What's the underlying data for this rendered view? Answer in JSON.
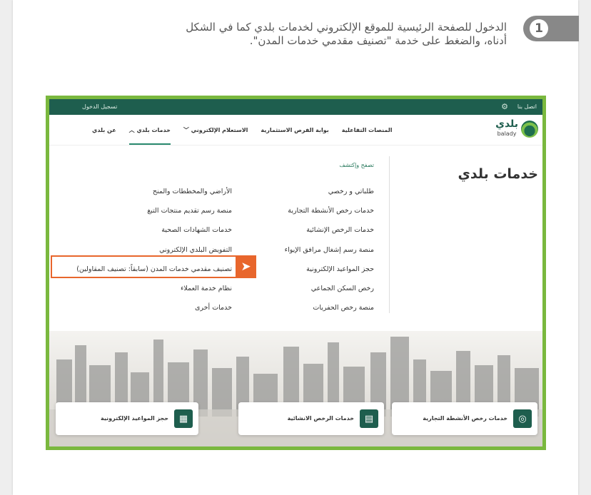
{
  "step": {
    "number": "1",
    "line1": "الدخول للصفحة الرئيسية للموقع الإلكتروني لخدمات بلدي كما في الشكل",
    "line2": "أدناه، والضغط على خدمة \"تصنيف مقدمي خدمات المدن\"."
  },
  "site": {
    "topbar": {
      "contact": "اتصل بنا",
      "login": "تسجيل الدخول",
      "settings_icon": "gear-icon"
    },
    "logo": {
      "ar": "بلدي",
      "en": "balady"
    },
    "nav": [
      "عن بلدي",
      "خدمات بلدي",
      "الاستعلام الإلكتروني",
      "بوابة الفرص الاستثمارية",
      "المنصات التفاعلية"
    ],
    "menu_title": "خدمات بلدي",
    "explore": "تصفح وإكتشف",
    "col_right": [
      "طلباتي و رخصي",
      "خدمات رخص الأنشطة التجارية",
      "خدمات الرخص الإنشائية",
      "منصة رسم إشغال مرافق الإيواء",
      "حجز المواعيد الإلكترونية",
      "رخص السكن الجماعي",
      "منصة رخص الحفريات"
    ],
    "col_left": [
      "الأراضي والمخططات والمنح",
      "منصة رسم تقديم منتجات التبغ",
      "خدمات الشهادات الصحية",
      "التفويض البلدي الإلكتروني",
      "تصنيف مقدمي خدمات المدن (سابقاً: تصنيف المقاولين)",
      "نظام خدمة العملاء",
      "خدمات أخرى"
    ],
    "cards": [
      "خدمات رخص الأنشطة التجارية",
      "خدمات الرخص الانشائية",
      "حجز المواعيد الإلكترونية"
    ],
    "colors": {
      "brand": "#1e5e4e",
      "accent": "#7ab83e",
      "highlight": "#e8662c"
    }
  }
}
